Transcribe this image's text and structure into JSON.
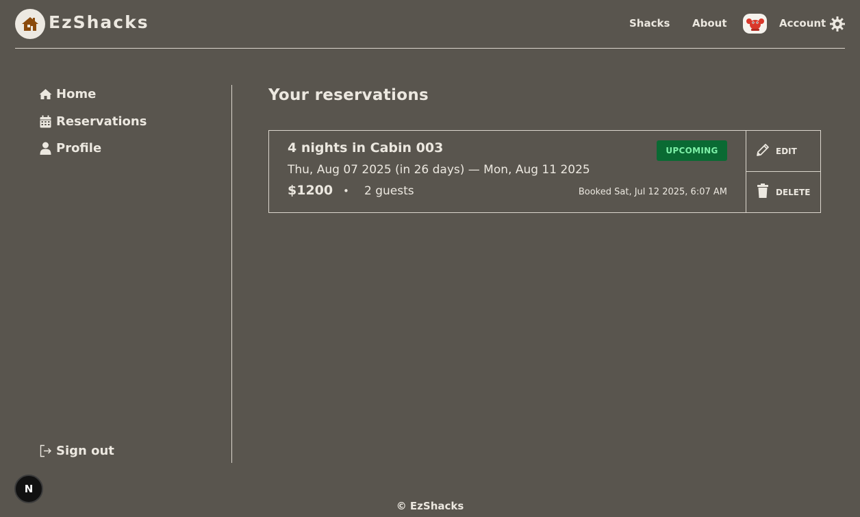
{
  "header": {
    "brand": "EzShacks",
    "nav": {
      "shacks": "Shacks",
      "about": "About",
      "account": "Account"
    },
    "icons": {
      "logo": "house-icon",
      "avatar": "lobster-avatar",
      "settings": "gear-icon"
    }
  },
  "sidebar": {
    "items": [
      {
        "label": "Home",
        "icon": "home-icon"
      },
      {
        "label": "Reservations",
        "icon": "calendar-icon"
      },
      {
        "label": "Profile",
        "icon": "user-icon"
      }
    ],
    "sign_out": {
      "label": "Sign out",
      "icon": "sign-out-icon"
    }
  },
  "main": {
    "title": "Your reservations",
    "reservations": [
      {
        "title": "4 nights in Cabin 003",
        "dates": "Thu, Aug 07 2025 (in 26 days) — Mon, Aug 11 2025",
        "price": "$1200",
        "separator": "•",
        "guests": "2 guests",
        "booked": "Booked Sat, Jul 12 2025, 6:07 AM",
        "status": "UPCOMING",
        "actions": {
          "edit": "EDIT",
          "delete": "DELETE"
        }
      }
    ]
  },
  "footer": {
    "copyright": "© EzShacks"
  },
  "dev_badge": {
    "label": "N"
  },
  "colors": {
    "background": "#59554e",
    "text": "#ece8e0",
    "status_bg": "#0a6a33",
    "status_text": "#7ef0a8",
    "logo_house": "#8a4a0c"
  }
}
